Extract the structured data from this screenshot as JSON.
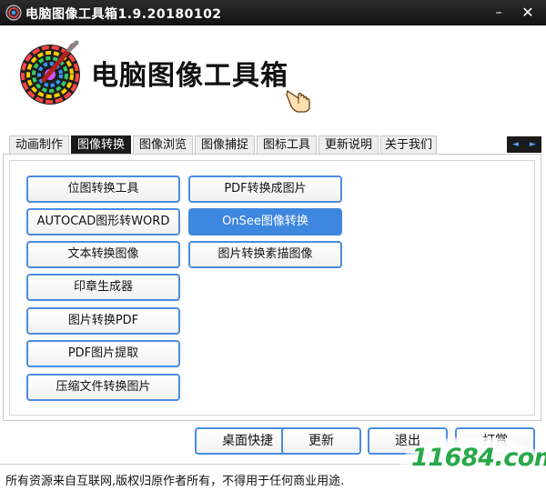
{
  "window": {
    "title": "电脑图像工具箱1.9.20180102",
    "minimize_glyph": "–",
    "close_glyph": "✕"
  },
  "header": {
    "title": "电脑图像工具箱"
  },
  "tabs": [
    {
      "label": "动画制作",
      "active": false
    },
    {
      "label": "图像转换",
      "active": true
    },
    {
      "label": "图像浏览",
      "active": false
    },
    {
      "label": "图像捕捉",
      "active": false
    },
    {
      "label": "图标工具",
      "active": false
    },
    {
      "label": "更新说明",
      "active": false
    },
    {
      "label": "关于我们",
      "active": false
    }
  ],
  "tab_scroll": {
    "left": "◄",
    "right": "►"
  },
  "tools_left": [
    "位图转换工具",
    "AUTOCAD图形转WORD",
    "文本转换图像",
    "印章生成器",
    "图片转换PDF",
    "PDF图片提取",
    "压缩文件转换图片"
  ],
  "tools_right": [
    "PDF转换成图片",
    "OnSee图像转换",
    "图片转换素描图像"
  ],
  "selected_tool": "OnSee图像转换",
  "bottom_buttons": {
    "desktop_shortcut": "桌面快捷",
    "update": "更新",
    "exit": "退出",
    "tip": "打赏"
  },
  "status": {
    "text": "所有资源来自互联网,版权归原作者所有，不得用于任何商业用途."
  },
  "watermark": {
    "text": "11684.com"
  },
  "colors": {
    "titlebar": "#1a1a1a",
    "button_border": "#4a8de0",
    "selected_button": "#3e87e0",
    "watermark": "#2aa84a"
  }
}
